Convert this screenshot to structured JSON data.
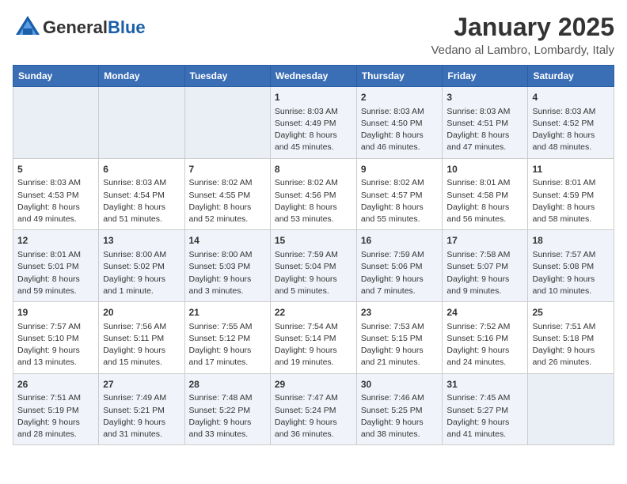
{
  "header": {
    "logo_line1": "General",
    "logo_line2": "Blue",
    "month": "January 2025",
    "location": "Vedano al Lambro, Lombardy, Italy"
  },
  "days_of_week": [
    "Sunday",
    "Monday",
    "Tuesday",
    "Wednesday",
    "Thursday",
    "Friday",
    "Saturday"
  ],
  "weeks": [
    [
      {
        "day": null,
        "info": null
      },
      {
        "day": null,
        "info": null
      },
      {
        "day": null,
        "info": null
      },
      {
        "day": "1",
        "info": "Sunrise: 8:03 AM\nSunset: 4:49 PM\nDaylight: 8 hours and 45 minutes."
      },
      {
        "day": "2",
        "info": "Sunrise: 8:03 AM\nSunset: 4:50 PM\nDaylight: 8 hours and 46 minutes."
      },
      {
        "day": "3",
        "info": "Sunrise: 8:03 AM\nSunset: 4:51 PM\nDaylight: 8 hours and 47 minutes."
      },
      {
        "day": "4",
        "info": "Sunrise: 8:03 AM\nSunset: 4:52 PM\nDaylight: 8 hours and 48 minutes."
      }
    ],
    [
      {
        "day": "5",
        "info": "Sunrise: 8:03 AM\nSunset: 4:53 PM\nDaylight: 8 hours and 49 minutes."
      },
      {
        "day": "6",
        "info": "Sunrise: 8:03 AM\nSunset: 4:54 PM\nDaylight: 8 hours and 51 minutes."
      },
      {
        "day": "7",
        "info": "Sunrise: 8:02 AM\nSunset: 4:55 PM\nDaylight: 8 hours and 52 minutes."
      },
      {
        "day": "8",
        "info": "Sunrise: 8:02 AM\nSunset: 4:56 PM\nDaylight: 8 hours and 53 minutes."
      },
      {
        "day": "9",
        "info": "Sunrise: 8:02 AM\nSunset: 4:57 PM\nDaylight: 8 hours and 55 minutes."
      },
      {
        "day": "10",
        "info": "Sunrise: 8:01 AM\nSunset: 4:58 PM\nDaylight: 8 hours and 56 minutes."
      },
      {
        "day": "11",
        "info": "Sunrise: 8:01 AM\nSunset: 4:59 PM\nDaylight: 8 hours and 58 minutes."
      }
    ],
    [
      {
        "day": "12",
        "info": "Sunrise: 8:01 AM\nSunset: 5:01 PM\nDaylight: 8 hours and 59 minutes."
      },
      {
        "day": "13",
        "info": "Sunrise: 8:00 AM\nSunset: 5:02 PM\nDaylight: 9 hours and 1 minute."
      },
      {
        "day": "14",
        "info": "Sunrise: 8:00 AM\nSunset: 5:03 PM\nDaylight: 9 hours and 3 minutes."
      },
      {
        "day": "15",
        "info": "Sunrise: 7:59 AM\nSunset: 5:04 PM\nDaylight: 9 hours and 5 minutes."
      },
      {
        "day": "16",
        "info": "Sunrise: 7:59 AM\nSunset: 5:06 PM\nDaylight: 9 hours and 7 minutes."
      },
      {
        "day": "17",
        "info": "Sunrise: 7:58 AM\nSunset: 5:07 PM\nDaylight: 9 hours and 9 minutes."
      },
      {
        "day": "18",
        "info": "Sunrise: 7:57 AM\nSunset: 5:08 PM\nDaylight: 9 hours and 10 minutes."
      }
    ],
    [
      {
        "day": "19",
        "info": "Sunrise: 7:57 AM\nSunset: 5:10 PM\nDaylight: 9 hours and 13 minutes."
      },
      {
        "day": "20",
        "info": "Sunrise: 7:56 AM\nSunset: 5:11 PM\nDaylight: 9 hours and 15 minutes."
      },
      {
        "day": "21",
        "info": "Sunrise: 7:55 AM\nSunset: 5:12 PM\nDaylight: 9 hours and 17 minutes."
      },
      {
        "day": "22",
        "info": "Sunrise: 7:54 AM\nSunset: 5:14 PM\nDaylight: 9 hours and 19 minutes."
      },
      {
        "day": "23",
        "info": "Sunrise: 7:53 AM\nSunset: 5:15 PM\nDaylight: 9 hours and 21 minutes."
      },
      {
        "day": "24",
        "info": "Sunrise: 7:52 AM\nSunset: 5:16 PM\nDaylight: 9 hours and 24 minutes."
      },
      {
        "day": "25",
        "info": "Sunrise: 7:51 AM\nSunset: 5:18 PM\nDaylight: 9 hours and 26 minutes."
      }
    ],
    [
      {
        "day": "26",
        "info": "Sunrise: 7:51 AM\nSunset: 5:19 PM\nDaylight: 9 hours and 28 minutes."
      },
      {
        "day": "27",
        "info": "Sunrise: 7:49 AM\nSunset: 5:21 PM\nDaylight: 9 hours and 31 minutes."
      },
      {
        "day": "28",
        "info": "Sunrise: 7:48 AM\nSunset: 5:22 PM\nDaylight: 9 hours and 33 minutes."
      },
      {
        "day": "29",
        "info": "Sunrise: 7:47 AM\nSunset: 5:24 PM\nDaylight: 9 hours and 36 minutes."
      },
      {
        "day": "30",
        "info": "Sunrise: 7:46 AM\nSunset: 5:25 PM\nDaylight: 9 hours and 38 minutes."
      },
      {
        "day": "31",
        "info": "Sunrise: 7:45 AM\nSunset: 5:27 PM\nDaylight: 9 hours and 41 minutes."
      },
      {
        "day": null,
        "info": null
      }
    ]
  ]
}
